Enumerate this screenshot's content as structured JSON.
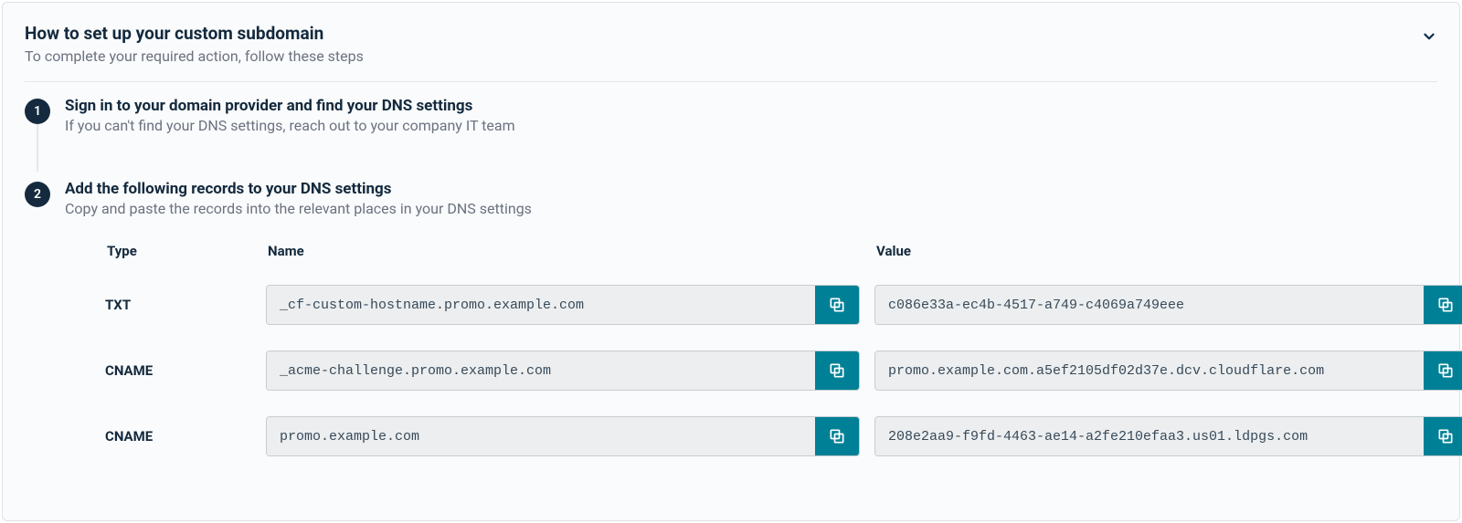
{
  "panel": {
    "title": "How to set up your custom subdomain",
    "subtitle": "To complete your required action, follow these steps"
  },
  "steps": [
    {
      "number": "1",
      "title": "Sign in to your domain provider and find your DNS settings",
      "desc": "If you can't find your DNS settings, reach out to your company IT team"
    },
    {
      "number": "2",
      "title": "Add the following records to your DNS settings",
      "desc": "Copy and paste the records into the relevant places in your DNS settings"
    }
  ],
  "dns": {
    "headers": {
      "type": "Type",
      "name": "Name",
      "value": "Value"
    },
    "records": [
      {
        "type": "TXT",
        "name": "_cf-custom-hostname.promo.example.com",
        "value": "c086e33a-ec4b-4517-a749-c4069a749eee"
      },
      {
        "type": "CNAME",
        "name": "_acme-challenge.promo.example.com",
        "value": "promo.example.com.a5ef2105df02d37e.dcv.cloudflare.com"
      },
      {
        "type": "CNAME",
        "name": "promo.example.com",
        "value": "208e2aa9-f9fd-4463-ae14-a2fe210efaa3.us01.ldpgs.com"
      }
    ]
  },
  "colors": {
    "accent": "#008096",
    "badge": "#152a3e"
  }
}
